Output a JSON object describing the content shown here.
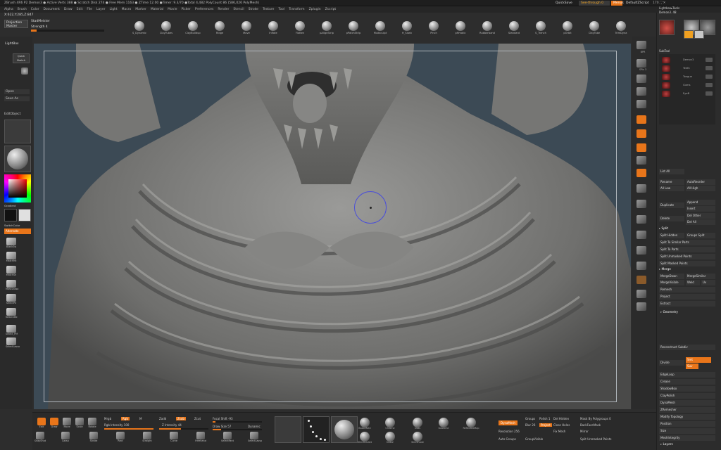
{
  "titlebar": {
    "text": "ZBrush 4R6 P2   Demon3  ● Active Verts 388 ● Scratch Disk 274 ● Free Mem 1163 ● ZTime 12.00 ●Timer: 9.3/70 ●Total 4,482 PolyCount 86 (586,026 PolyMesh)",
    "quicksave": "QuickSave",
    "see_through": "See-through   0",
    "menus": "Menus",
    "default_zscript": "DefaultZScript",
    "right_info": "170   ⛶   ✕"
  },
  "menubar": [
    "Alpha",
    "Brush",
    "Color",
    "Document",
    "Draw",
    "Edit",
    "File",
    "Layer",
    "Light",
    "Macro",
    "Marker",
    "Material",
    "Movie",
    "Picker",
    "Preferences",
    "Render",
    "Stencil",
    "Stroke",
    "Texture",
    "Tool",
    "Transform",
    "Zplugin",
    "Zscript"
  ],
  "top_left": {
    "coords": "X:622,Y:285,Z:847",
    "projection_btn": "Projection Master",
    "zbrush_label": "StadMeister",
    "strength_label": "Strength 4"
  },
  "brushes": [
    {
      "name": "S_Dynamic"
    },
    {
      "name": "ClayTubes"
    },
    {
      "name": "ClayBuildup"
    },
    {
      "name": "Ridge"
    },
    {
      "name": "Move"
    },
    {
      "name": "Inflate"
    },
    {
      "name": "Flatten"
    },
    {
      "name": "pAlignStrip"
    },
    {
      "name": "pPatchStrip"
    },
    {
      "name": "Mudsculpt"
    },
    {
      "name": "H_Slash"
    },
    {
      "name": "Pinch"
    },
    {
      "name": "pHmatic"
    },
    {
      "name": "Rubberband"
    },
    {
      "name": "Standard"
    },
    {
      "name": "S_Trench"
    },
    {
      "name": "pOrbit"
    },
    {
      "name": "ClayTube"
    },
    {
      "name": "TrimDyna"
    }
  ],
  "left_tray": {
    "lightbox": "LightBox",
    "quicksketch": "Quick Sketch",
    "open": "Open",
    "save_as": "Save As",
    "edit_obj": "EditObject",
    "gradient": "Gradient",
    "switchcolor": "SwitchColor",
    "alternate": "Alternate",
    "tool_buttons": [
      "BlankSw",
      "MatchMt",
      "MatchSh",
      "MaskLasso",
      "SelectRt",
      "NaturalBc",
      "Select_PM",
      "SelectLasso"
    ],
    "colors": {
      "primary": "#111111",
      "secondary": "#e0e0e0",
      "accent": "#e8751a"
    }
  },
  "right_tray": {
    "items": [
      "BPR",
      "SPix 3",
      "Scroll",
      "Zoom",
      "Actual",
      "AAHalf",
      "Persp",
      "Floor",
      "Local",
      "L.Sym",
      "Xyz",
      "Frame",
      "Move",
      "Scale",
      "Rotate",
      "PolyF",
      "Transp",
      "Ghost",
      "Solo",
      "Xpose"
    ]
  },
  "right_panel": {
    "lightbox_tools": "Lightbox▸Tools",
    "demon": "Demon3. 48",
    "subtool_header": "SubTool",
    "subtools": [
      "Demon3",
      "Teeth",
      "Tongue",
      "Gums",
      "EyeB"
    ],
    "list_all": "List All",
    "rename": "Rename",
    "auto_reorder": "AutoReorder",
    "all_low": "All Low",
    "all_high": "All High",
    "duplicate": "Duplicate",
    "append": "Append",
    "insert": "Insert",
    "delete": "Delete",
    "del_other": "Del Other",
    "del_all": "Del All",
    "split_hdr": "Split",
    "split_hidden": "Split Hidden",
    "groups_split": "Groups Split",
    "split_similar": "Split To Similar Parts",
    "split_parts": "Split To Parts",
    "split_unmasked": "Split Unmasked Points",
    "split_masked": "Split Masked Points",
    "merge_hdr": "Merge",
    "merge_down": "MergeDown",
    "merge_similar": "MergeSimilar",
    "merge_visible": "MergeVisible",
    "weld": "Weld",
    "uv": "Uv",
    "remesh": "Remesh",
    "project": "Project",
    "extract": "Extract",
    "geometry_hdr": "Geometry",
    "reconstruct": "Reconstruct Subdiv",
    "divide": "Divide",
    "smt": "Smt",
    "suv": "Suv",
    "edgeloop": "EdgeLoop",
    "crease": "Crease",
    "shadowbox": "ShadowBox",
    "claypolish": "ClayPolish",
    "dynamesh": "DynaMesh",
    "zremesher": "ZRemesher",
    "modify_topology": "Modify Topology",
    "position": "Position",
    "size": "Size",
    "meshintegrity": "MeshIntegrity",
    "layers": "Layers"
  },
  "bottom": {
    "tools": [
      {
        "name": "Edit",
        "active": true
      },
      {
        "name": "Draw",
        "active": true
      },
      {
        "name": "Move"
      },
      {
        "name": "Scale"
      },
      {
        "name": "Rotate"
      }
    ],
    "mrgb": "Mrgb",
    "rgb": "Rgb",
    "m": "M",
    "rgb_intensity": "Rgb Intensity 100",
    "zadd": "Zadd",
    "zsub": "Zsub",
    "zcut": "Zcut",
    "z_intensity": "Z Intensity 44",
    "focal_shift": "Focal Shift -93",
    "draw_size": "Draw Size 57",
    "dynamic": "Dynamic",
    "materials": [
      "BasicMate",
      "Chrome",
      "Dots",
      "Gouache",
      "ReflectedMap",
      "SkinShade4",
      "Dots2",
      "SkinShade"
    ],
    "dynamesh": "DynaMesh",
    "groups": "Groups",
    "polish": "Polish 1",
    "blur": "Blur 26",
    "project": "Project",
    "resolution": "Resolution 256",
    "del_hidden": "Del Hidden",
    "close_holes": "Close Holes",
    "fix_mesh": "Fix Mesh",
    "auto_groups": "Auto Groups",
    "group_visible": "GroupVisible",
    "mask_by_polygroups": "Mask By Polygroups 0",
    "backface_mask": "BackFaceMask",
    "mirror": "Mirror",
    "split_unmasked": "Split Unmasked Points",
    "edit_tools": [
      "SnapShot",
      "Lasso",
      "Stroke",
      "Rect",
      "Straight",
      "Curve",
      "Freehand",
      "SelectRect",
      "SelectLasso"
    ]
  }
}
